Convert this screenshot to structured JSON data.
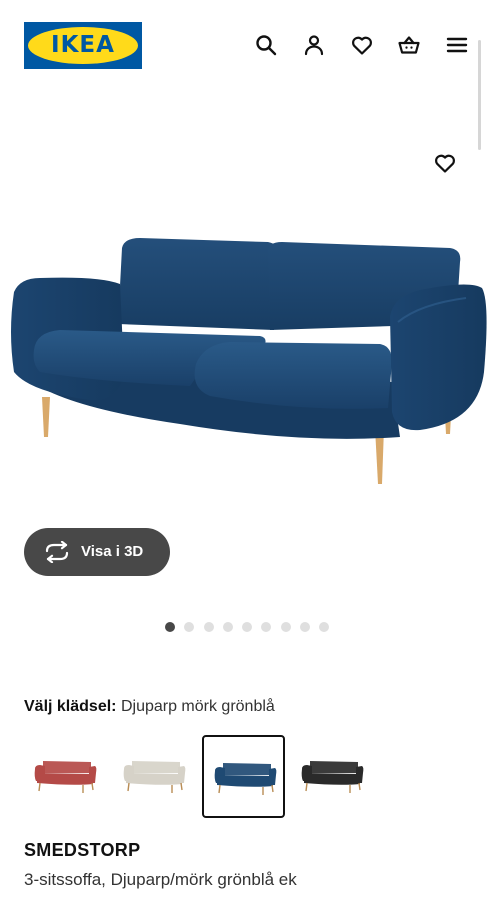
{
  "header": {
    "logo_text": "IKEA",
    "icons": [
      "search-icon",
      "profile-icon",
      "heart-icon",
      "cart-icon",
      "menu-icon"
    ]
  },
  "gallery": {
    "current_image": 1,
    "image_count": 9,
    "view_3d_label": "Visa i 3D"
  },
  "finish": {
    "label": "Välj klädsel:",
    "selected_value": "Djuparp mörk grönblå",
    "options": [
      {
        "color": "#b44a47",
        "selected": false
      },
      {
        "color": "#d6d2c8",
        "selected": false
      },
      {
        "color": "#1f4a73",
        "selected": true
      },
      {
        "color": "#2a2a2a",
        "selected": false
      }
    ]
  },
  "product": {
    "name": "SMEDSTORP",
    "description": "3-sitssoffa, Djuparp/mörk grönblå ek"
  },
  "colors": {
    "brand_blue": "#0058a3",
    "brand_yellow": "#ffda1a",
    "sofa_blue": "#1f4a73",
    "button_dark": "#484848"
  }
}
